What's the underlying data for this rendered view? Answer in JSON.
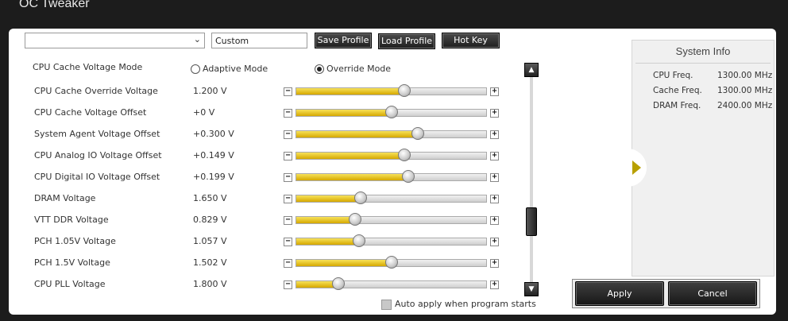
{
  "window": {
    "title": "OC Tweaker"
  },
  "profile": {
    "selected": "",
    "name": "Custom",
    "save_label": "Save Profile",
    "load_label": "Load Profile",
    "hotkey_label": "Hot Key"
  },
  "cache_mode": {
    "label": "CPU Cache Voltage Mode",
    "adaptive_label": "Adaptive Mode",
    "override_label": "Override Mode",
    "selected": "Override Mode"
  },
  "settings": [
    {
      "label": "CPU Cache Override Voltage",
      "value": "1.200 V",
      "level": 0.57
    },
    {
      "label": "CPU Cache Voltage Offset",
      "value": "+0 V",
      "level": 0.5
    },
    {
      "label": "System Agent Voltage Offset",
      "value": "+0.300 V",
      "level": 0.64
    },
    {
      "label": "CPU Analog IO Voltage Offset",
      "value": "+0.149 V",
      "level": 0.57
    },
    {
      "label": "CPU Digital IO Voltage Offset",
      "value": "+0.199 V",
      "level": 0.59
    },
    {
      "label": "DRAM Voltage",
      "value": "1.650 V",
      "level": 0.34
    },
    {
      "label": "VTT DDR Voltage",
      "value": "0.829 V",
      "level": 0.31
    },
    {
      "label": "PCH 1.05V Voltage",
      "value": "1.057 V",
      "level": 0.33
    },
    {
      "label": "PCH 1.5V Voltage",
      "value": "1.502 V",
      "level": 0.5
    },
    {
      "label": "CPU PLL Voltage",
      "value": "1.800 V",
      "level": 0.22
    }
  ],
  "auto_apply": {
    "label": "Auto apply when program starts",
    "checked": false
  },
  "system_info": {
    "title": "System Info",
    "rows": [
      {
        "label": "CPU Freq.",
        "value": "1300.00 MHz"
      },
      {
        "label": "Cache Freq.",
        "value": "1300.00 MHz"
      },
      {
        "label": "DRAM Freq.",
        "value": "2400.00 MHz"
      }
    ]
  },
  "actions": {
    "apply_label": "Apply",
    "cancel_label": "Cancel"
  },
  "colors": {
    "accent": "#d6a800",
    "background": "#1c1c1c"
  }
}
